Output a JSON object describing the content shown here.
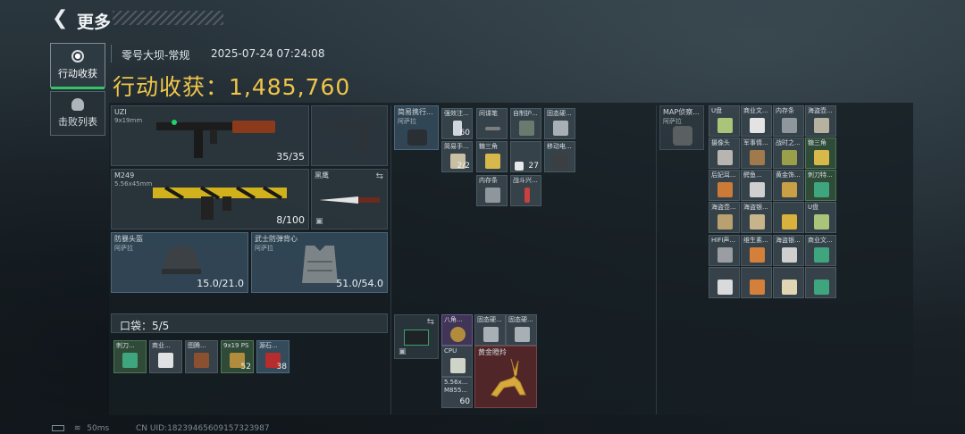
{
  "header": {
    "back_icon": "back-arrow-icon",
    "title": "更多"
  },
  "tabs": [
    {
      "label": "行动收获",
      "icon": "target-icon",
      "active": true
    },
    {
      "label": "击败列表",
      "icon": "skull-icon",
      "active": false
    }
  ],
  "match": {
    "map": "零号大坝-常规",
    "datetime": "2025-07-24 07:24:08",
    "harvest_label": "行动收获：",
    "harvest_value": "1,485,760"
  },
  "loadout": {
    "primary": {
      "name": "UZI",
      "sub": "9x19mm",
      "ammo": "35/35"
    },
    "secondary": {
      "name": "M249",
      "sub": "5.56x45mm",
      "ammo": "8/100"
    },
    "melee": {
      "name": "黑鹰"
    },
    "helmet": {
      "name": "防暴头盔",
      "sub": "阿萨拉",
      "durability": "15.0/21.0"
    },
    "armor": {
      "name": "武士防弹背心",
      "sub": "阿萨拉",
      "durability": "51.0/54.0"
    }
  },
  "pocket": {
    "label": "口袋：5/5",
    "items": [
      {
        "label": "刺刀...",
        "count": ""
      },
      {
        "label": "商业...",
        "count": ""
      },
      {
        "label": "图腾...",
        "count": ""
      },
      {
        "label": "9x19 PS",
        "count": "52"
      },
      {
        "label": "源石...",
        "count": "38"
      }
    ]
  },
  "rig": {
    "name": "简易携行...",
    "sub": "阿萨拉",
    "items": [
      {
        "label": "强效注...",
        "count": "60"
      },
      {
        "label": "间谍笔",
        "count": ""
      },
      {
        "label": "自制护...",
        "count": ""
      },
      {
        "label": "固态硬...",
        "count": ""
      },
      {
        "label": "简易手...",
        "count": "2/2"
      },
      {
        "label": "糖三角",
        "count": ""
      },
      {
        "label": "",
        "count": "27"
      },
      {
        "label": "移动电...",
        "count": ""
      },
      {
        "label": "内存条",
        "count": ""
      },
      {
        "label": "战斗兴...",
        "count": ""
      }
    ]
  },
  "backpack_case": {
    "items": [
      {
        "label": "八角...",
        "count": ""
      },
      {
        "label": "固态硬...",
        "count": ""
      },
      {
        "label": "固态硬...",
        "count": ""
      },
      {
        "label": "CPU",
        "count": ""
      },
      {
        "label": "黄金瞪羚",
        "count": ""
      },
      {
        "label": "5.56x... M855...",
        "count": "60"
      }
    ]
  },
  "backpack": {
    "name": "MAP侦察...",
    "sub": "阿萨拉",
    "grid1": [
      "U盘",
      "商业文...",
      "内存条",
      "海盗壶...",
      "摄像头",
      "军事情...",
      "战时之...",
      "糖三角",
      "后妃耳...",
      "鳄鱼...",
      "黄金饰...",
      "刺刀特...",
      "海盗壶...",
      "海盗银...",
      "",
      "U盘"
    ],
    "grid2": [
      "HIFI声...",
      "维生素...",
      "海盗银...",
      "商业文...",
      "",
      "",
      "",
      ""
    ]
  },
  "footer": {
    "ping": "50ms",
    "uid": "CN UID:18239465609157323987"
  },
  "colors": {
    "accent_gold": "#f0c64a",
    "active_green": "#35c46a"
  }
}
